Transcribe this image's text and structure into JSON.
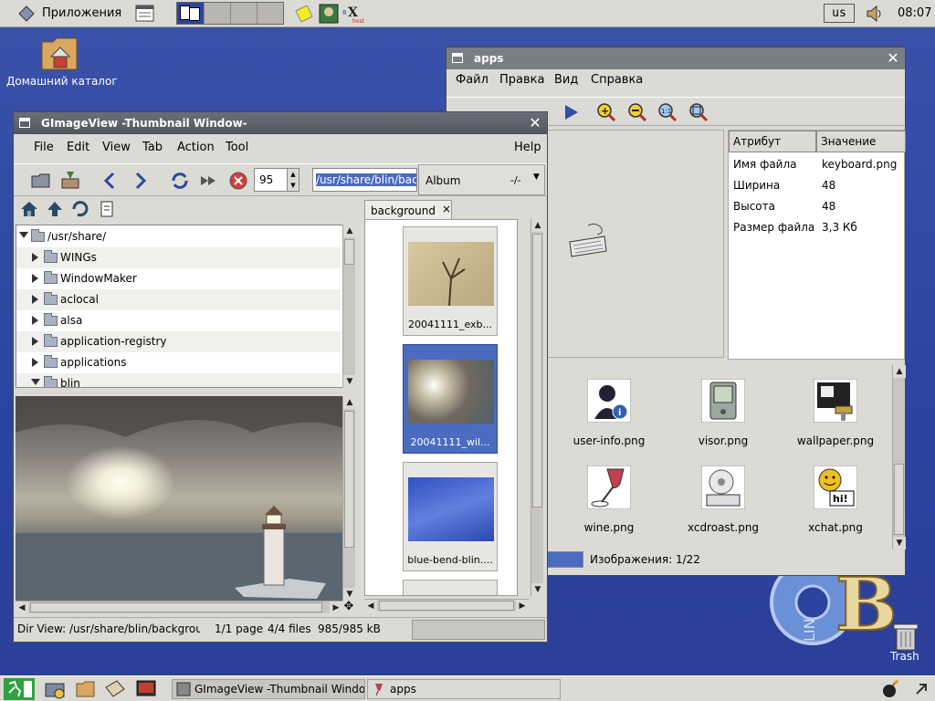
{
  "top_panel": {
    "apps_menu": "Приложения",
    "keyboard_layout": "us",
    "clock": "08:07"
  },
  "desktop": {
    "home_icon_label": "Домашний каталог",
    "trash_label": "Trash"
  },
  "apps_window": {
    "title": "apps",
    "menu": [
      "Файл",
      "Правка",
      "Вид",
      "Справка"
    ],
    "attr_headers": [
      "Атрибут",
      "Значение"
    ],
    "attributes": [
      {
        "key": "Имя файла",
        "value": "keyboard.png"
      },
      {
        "key": "Ширина",
        "value": "48"
      },
      {
        "key": "Высота",
        "value": "48"
      },
      {
        "key": "Размер файла",
        "value": "3,3 Кб"
      }
    ],
    "icons": [
      {
        "name": "user-info.png"
      },
      {
        "name": "visor.png"
      },
      {
        "name": "wallpaper.png"
      },
      {
        "name": "wine.png"
      },
      {
        "name": "xcdroast.png"
      },
      {
        "name": "xchat.png"
      }
    ],
    "status": "Изображения: 1/22"
  },
  "gimv_window": {
    "title": "GImageView -Thumbnail Window-",
    "menu": [
      "File",
      "Edit",
      "View",
      "Tab",
      "Action",
      "Tool"
    ],
    "help_label": "Help",
    "zoom_value": "95",
    "path_value": "/usr/share/blin/bac",
    "album_label": "Album",
    "album_count": "-/-",
    "tree": [
      {
        "label": "/usr/share/",
        "expanded": true
      },
      {
        "label": "WINGs"
      },
      {
        "label": "WindowMaker"
      },
      {
        "label": "aclocal"
      },
      {
        "label": "alsa"
      },
      {
        "label": "application-registry"
      },
      {
        "label": "applications"
      },
      {
        "label": "blin",
        "expanded": true
      }
    ],
    "tab_label": "background",
    "tab_close": "×",
    "thumbnails": [
      {
        "caption": "20041111_exb..."
      },
      {
        "caption": "20041111_wil..."
      },
      {
        "caption": "blue-bend-blin...."
      }
    ],
    "status": {
      "dir": "Dir View: /usr/share/blin/backgrou",
      "page": "1/1 page",
      "files": "4/4 files",
      "size": "985/985 kB"
    }
  },
  "taskbar": {
    "tasks": [
      "GImageView -Thumbnail Window",
      "apps"
    ]
  },
  "colors": {
    "desktop": "#2c44a0",
    "selection": "#4a6bbf",
    "titlebar": "#5f626b",
    "chrome": "#dcdad5"
  }
}
